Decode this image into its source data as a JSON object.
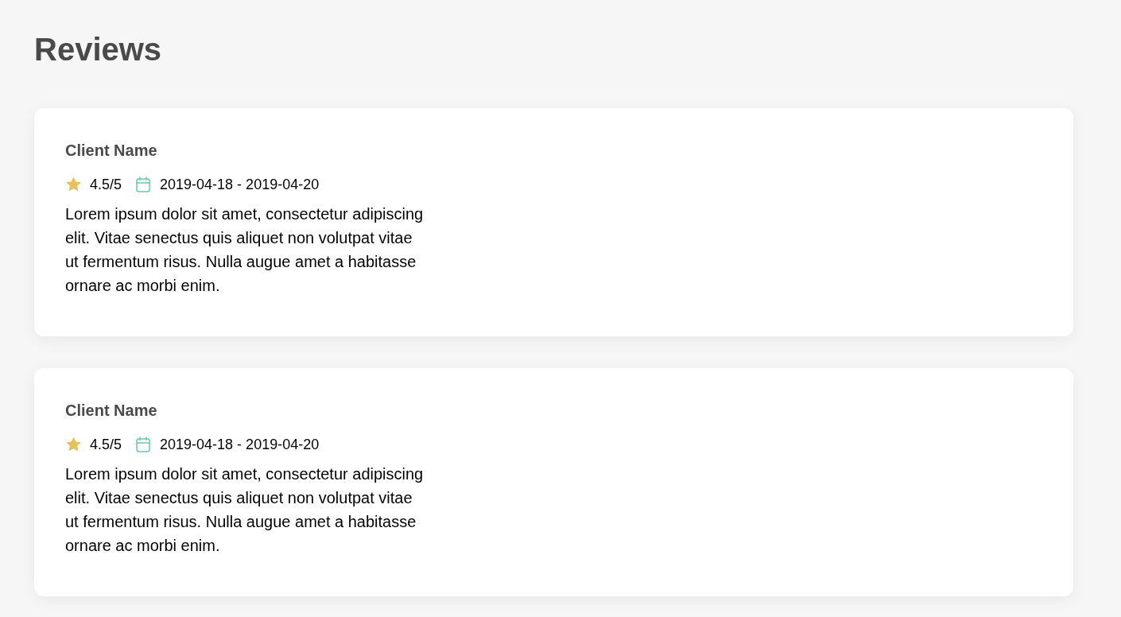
{
  "page": {
    "title": "Reviews"
  },
  "reviews": [
    {
      "client_name": "Client Name",
      "rating": "4.5/5",
      "dates": "2019-04-18 - 2019-04-20",
      "text": "Lorem ipsum dolor sit amet, consectetur adipiscing elit. Vitae senectus quis aliquet non volutpat vitae ut fermentum risus. Nulla augue amet a habitasse ornare ac morbi enim."
    },
    {
      "client_name": "Client Name",
      "rating": "4.5/5",
      "dates": "2019-04-18 - 2019-04-20",
      "text": "Lorem ipsum dolor sit amet, consectetur adipiscing elit. Vitae senectus quis aliquet non volutpat vitae ut fermentum risus. Nulla augue amet a habitasse ornare ac morbi enim."
    }
  ]
}
